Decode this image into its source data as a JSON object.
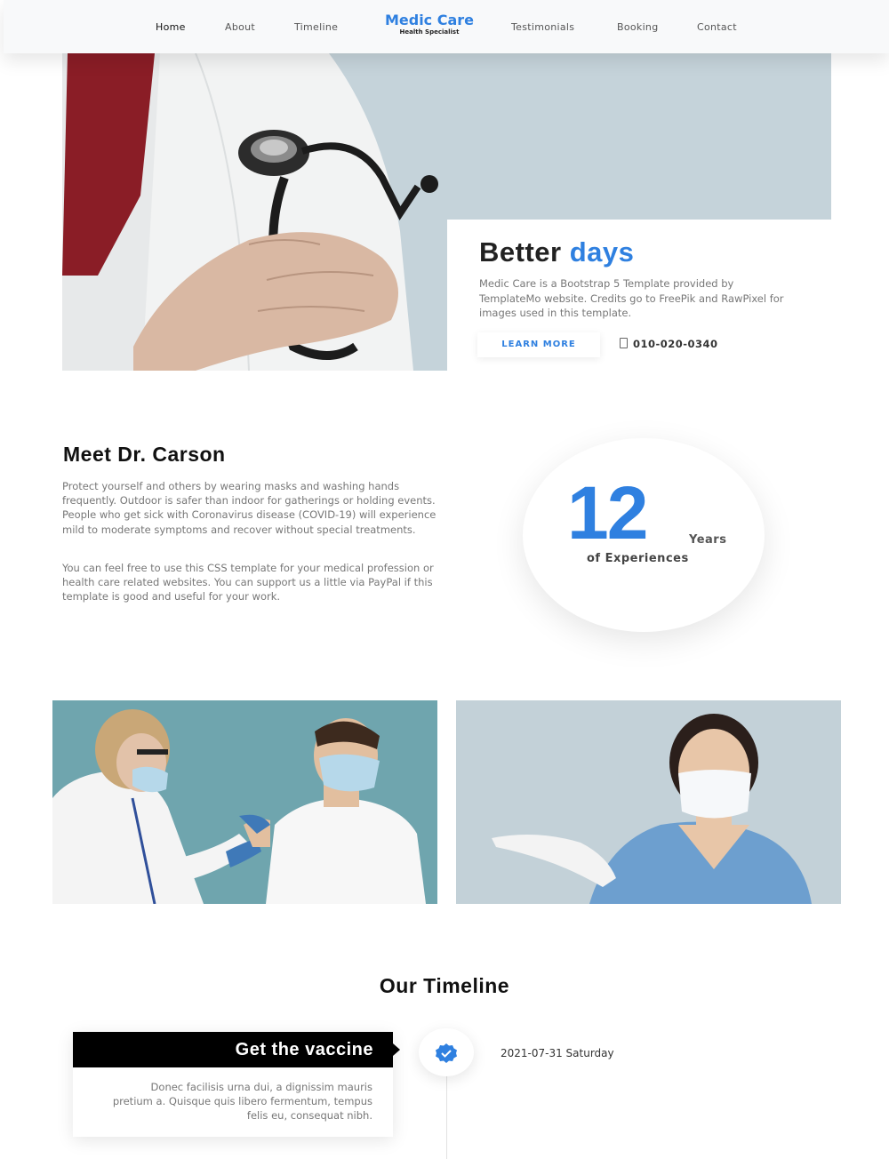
{
  "nav": {
    "brand_title": "Medic Care",
    "brand_subtitle": "Health Specialist",
    "links": [
      "Home",
      "About",
      "Timeline",
      "Testimonials",
      "Booking",
      "Contact"
    ]
  },
  "hero": {
    "title_main": "Better",
    "title_accent": "days",
    "text": "Medic Care is a Bootstrap 5 Template provided by TemplateMo website. Credits go to FreePik and RawPixel for images used in this template.",
    "button_label": "LEARN MORE",
    "phone": "010-020-0340"
  },
  "about": {
    "title": "Meet Dr. Carson",
    "paragraph_1": "Protect yourself and others by wearing masks and washing hands frequently. Outdoor is safer than indoor for gatherings or holding events. People who get sick with Coronavirus disease (COVID-19) will experience mild to moderate symptoms and recover without special treatments.",
    "paragraph_2": "You can feel free to use this CSS template for your medical profession or health care related websites. You can support us a little via PayPal if this template is good and useful for your work.",
    "experience_number": "12",
    "experience_unit": "Years",
    "experience_label": "of Experiences"
  },
  "timeline": {
    "title": "Our Timeline",
    "items": [
      {
        "title": "Get the vaccine",
        "text": "Donec facilisis urna dui, a dignissim mauris pretium a. Quisque quis libero fermentum, tempus felis eu, consequat nibh.",
        "date": "2021-07-31 Saturday"
      }
    ]
  },
  "colors": {
    "accent": "#2f80e0",
    "hero_bg": "#c5d3da",
    "gallery_left_bg": "#6fa5ae",
    "gallery_right_bg": "#c3d1d8"
  },
  "icons": {
    "phone": "phone-icon",
    "timeline_badge": "check-badge-icon"
  }
}
